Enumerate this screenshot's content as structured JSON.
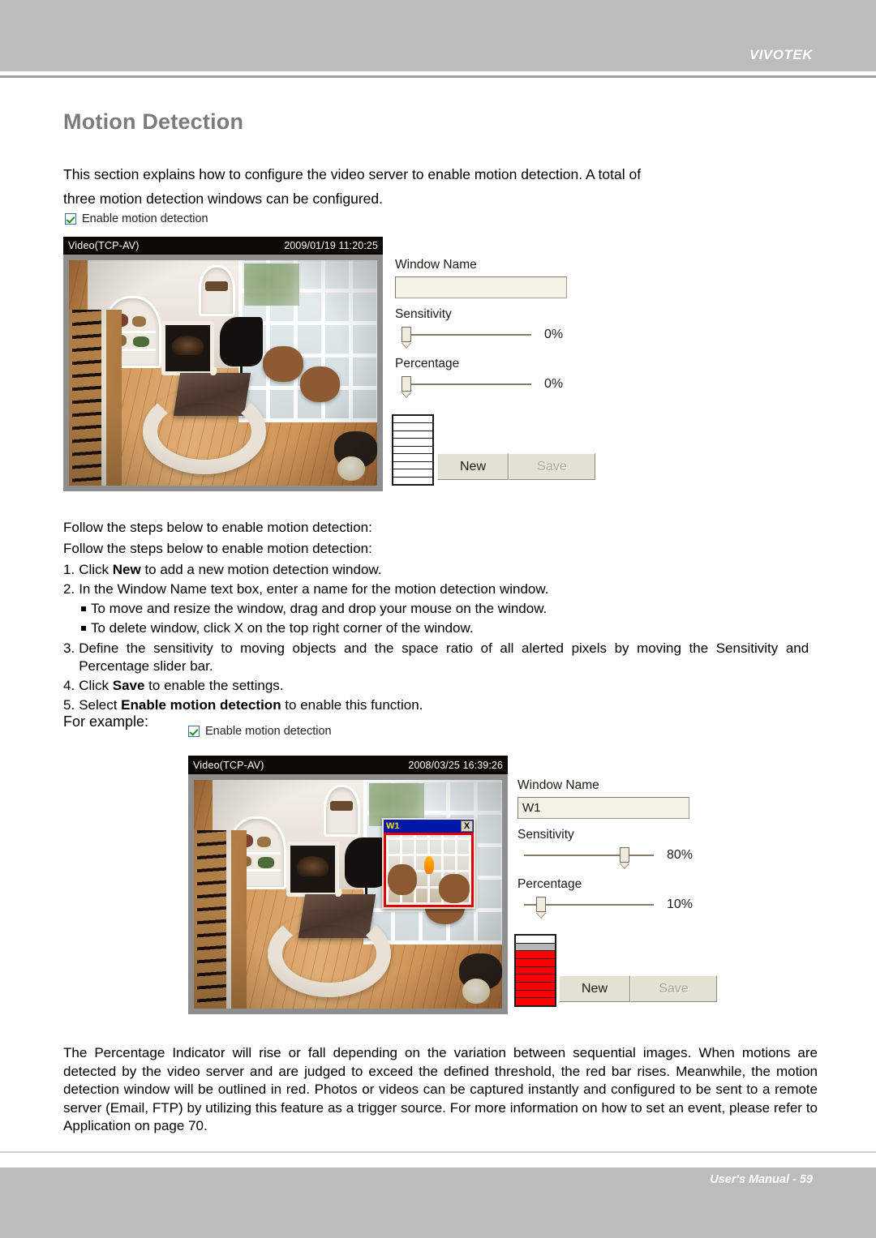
{
  "header": {
    "brand": "VIVOTEK"
  },
  "page": {
    "title": "Motion Detection",
    "intro_line1": "This section explains how to configure the video server to enable motion detection. A total of",
    "intro_line2": "three motion detection windows can be configured.",
    "for_example": "For example:"
  },
  "checkbox": {
    "label": "Enable motion detection",
    "checked": "true"
  },
  "panel_default": {
    "video": {
      "stream_name": "Video(TCP-AV)",
      "timestamp": "2009/01/19 11:20:25"
    },
    "form": {
      "window_name_label": "Window Name",
      "window_name_value": "",
      "window_name_placeholder": "",
      "sensitivity_label": "Sensitivity",
      "sensitivity_value": "0%",
      "percentage_label": "Percentage",
      "percentage_value": "0%",
      "new_button": "New",
      "save_button": "Save",
      "save_enabled": "false",
      "indicator_filled_segments": 0,
      "indicator_total_segments": 9
    }
  },
  "panel_example": {
    "video": {
      "stream_name": "Video(TCP-AV)",
      "timestamp": "2008/03/25 16:39:26"
    },
    "detection_window": {
      "name": "W1",
      "close_label": "X",
      "outline_color": "#e00000",
      "titlebar_color": "#0018a8",
      "title_text_color": "#ffe600"
    },
    "form": {
      "window_name_label": "Window Name",
      "window_name_value": "W1",
      "sensitivity_label": "Sensitivity",
      "sensitivity_value": "80%",
      "percentage_label": "Percentage",
      "percentage_value": "10%",
      "new_button": "New",
      "save_button": "Save",
      "save_enabled": "false",
      "indicator_filled_segments": 8,
      "indicator_total_segments": 9
    }
  },
  "instructions": {
    "lead1": "Follow the steps below to enable motion detection:",
    "lead2": "Follow the steps below to enable motion detection:",
    "step1_num": "1.",
    "step1_a": "Click ",
    "step1_b": "New",
    "step1_c": " to add a new motion detection window.",
    "step2_num": "2.",
    "step2_text": "In the Window Name text box, enter a name for the motion detection window.",
    "sub1": "To move and resize the window, drag and drop your mouse on the window.",
    "sub2": "To delete window, click X on the top right corner of the window.",
    "step3_num": "3.",
    "step3_text": "Define the sensitivity to moving objects and the space ratio of all alerted pixels by moving the Sensitivity and Percentage slider bar.",
    "step4_num": "4.",
    "step4_a": "Click ",
    "step4_b": "Save",
    "step4_c": " to enable the settings.",
    "step5_num": "5.",
    "step5_a": "Select ",
    "step5_b": "Enable motion detection",
    "step5_c": " to enable this function."
  },
  "outro": "The Percentage Indicator will rise or fall depending on the variation between sequential images. When motions are detected by the video server and are judged to exceed the defined threshold, the red bar rises. Meanwhile, the motion detection window will be outlined in red. Photos or videos can be captured instantly and configured to be sent to a remote server (Email, FTP) by utilizing this feature as a trigger source. For more information on how to set an event, please refer to Application on page 70.",
  "footer": {
    "text": "User's Manual - 59"
  },
  "colors": {
    "header_gray": "#bcbcbc",
    "title_gray": "#7b7b7b",
    "indicator_red": "#ff0000",
    "detection_blue": "#0018a8"
  }
}
